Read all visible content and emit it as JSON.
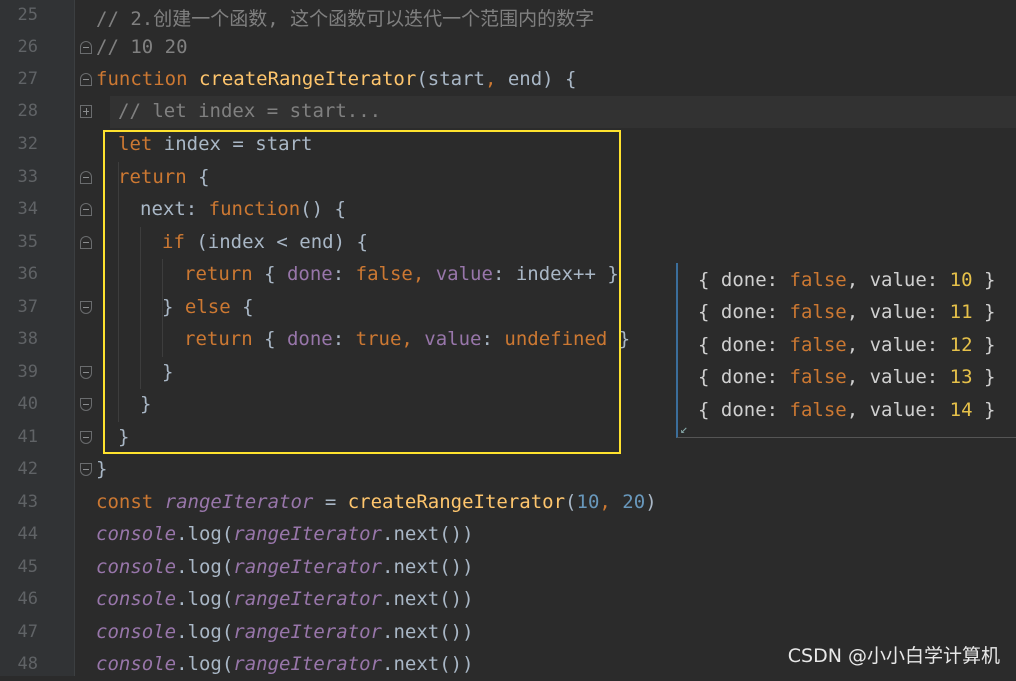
{
  "lines": [
    {
      "no": "25",
      "code": "// 2.创建一个函数, 这个函数可以迭代一个范围内的数字"
    },
    {
      "no": "26",
      "code": "// 10 20"
    },
    {
      "no": "27",
      "code": "function createRangeIterator(start, end) {"
    },
    {
      "no": "28",
      "code": "// let index = start..."
    },
    {
      "no": "32",
      "code": "let index = start"
    },
    {
      "no": "33",
      "code": "return {"
    },
    {
      "no": "34",
      "code": "next: function() {"
    },
    {
      "no": "35",
      "code": "if (index < end) {"
    },
    {
      "no": "36",
      "code": "return { done: false, value: index++ }"
    },
    {
      "no": "37",
      "code": "} else {"
    },
    {
      "no": "38",
      "code": "return { done: true, value: undefined }"
    },
    {
      "no": "39",
      "code": "}"
    },
    {
      "no": "40",
      "code": "}"
    },
    {
      "no": "41",
      "code": "}"
    },
    {
      "no": "42",
      "code": "}"
    },
    {
      "no": "43",
      "code": "const rangeIterator = createRangeIterator(10, 20)"
    },
    {
      "no": "44",
      "code": "console.log(rangeIterator.next())"
    },
    {
      "no": "45",
      "code": "console.log(rangeIterator.next())"
    },
    {
      "no": "46",
      "code": "console.log(rangeIterator.next())"
    },
    {
      "no": "47",
      "code": "console.log(rangeIterator.next())"
    },
    {
      "no": "48",
      "code": "console.log(rangeIterator.next())"
    }
  ],
  "console_output": [
    {
      "done": "false",
      "value": "10"
    },
    {
      "done": "false",
      "value": "11"
    },
    {
      "done": "false",
      "value": "12"
    },
    {
      "done": "false",
      "value": "13"
    },
    {
      "done": "false",
      "value": "14"
    }
  ],
  "console_labels": {
    "done_key": "done",
    "value_key": "value"
  },
  "watermark": "CSDN @小小白学计算机",
  "colors": {
    "highlight_border": "#ffe22e",
    "keyword": "#cc7832",
    "function": "#ffc66d",
    "property": "#9876aa",
    "number": "#6897bb",
    "comment": "#808080"
  }
}
